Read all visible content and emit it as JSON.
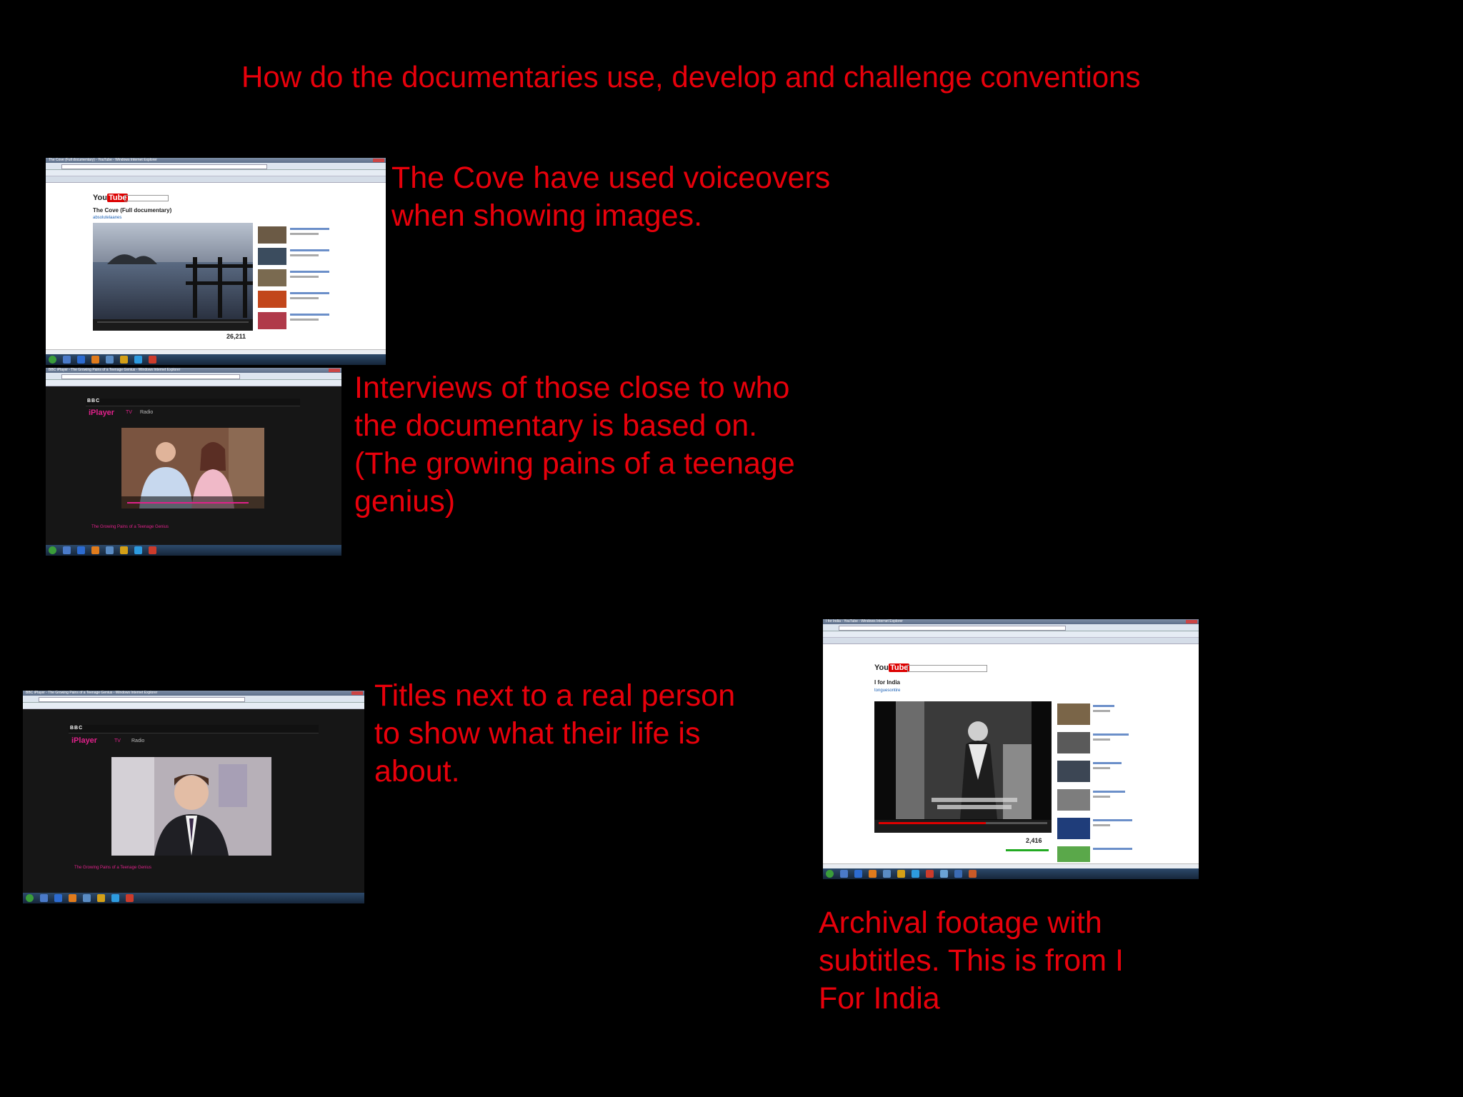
{
  "slide": {
    "title": "How do the documentaries use, develop and challenge conventions",
    "accent_color": "#e8000b",
    "captions": {
      "cove": [
        "The Cove have used voiceovers",
        "when showing images."
      ],
      "interviews": [
        "Interviews of those close to who",
        "the documentary is based on.",
        "(The growing pains of a teenage",
        "genius)"
      ],
      "titles": [
        "Titles next to a real person",
        "to show what their life is",
        "about."
      ],
      "archival": [
        "Archival footage with",
        "subtitles. This is from I",
        "For India"
      ]
    }
  },
  "screenshots": {
    "cove": {
      "window_title": "The Cove (Full documentary) - YouTube - Windows Internet Explorer",
      "logo_you": "You",
      "logo_tube": "Tube",
      "video_title": "The Cove (Full documentary)",
      "user": "absolutelaanes",
      "views": "26,211"
    },
    "iplayer1": {
      "window_title": "BBC iPlayer - The Growing Pains of a Teenage Genius - Windows Internet Explorer",
      "logo": "iPlayer",
      "nav_tv": "TV",
      "nav_radio": "Radio",
      "caption": "The Growing Pains of a Teenage Genius"
    },
    "iplayer2": {
      "window_title": "BBC iPlayer - The Growing Pains of a Teenage Genius - Windows Internet Explorer",
      "logo": "iPlayer",
      "nav_tv": "TV",
      "nav_radio": "Radio",
      "caption": "The Growing Pains of a Teenage Genius"
    },
    "india": {
      "window_title": "I for India - YouTube - Windows Internet Explorer",
      "logo_you": "You",
      "logo_tube": "Tube",
      "video_title": "I for India",
      "user": "tonguesontire",
      "views": "2,416"
    }
  }
}
